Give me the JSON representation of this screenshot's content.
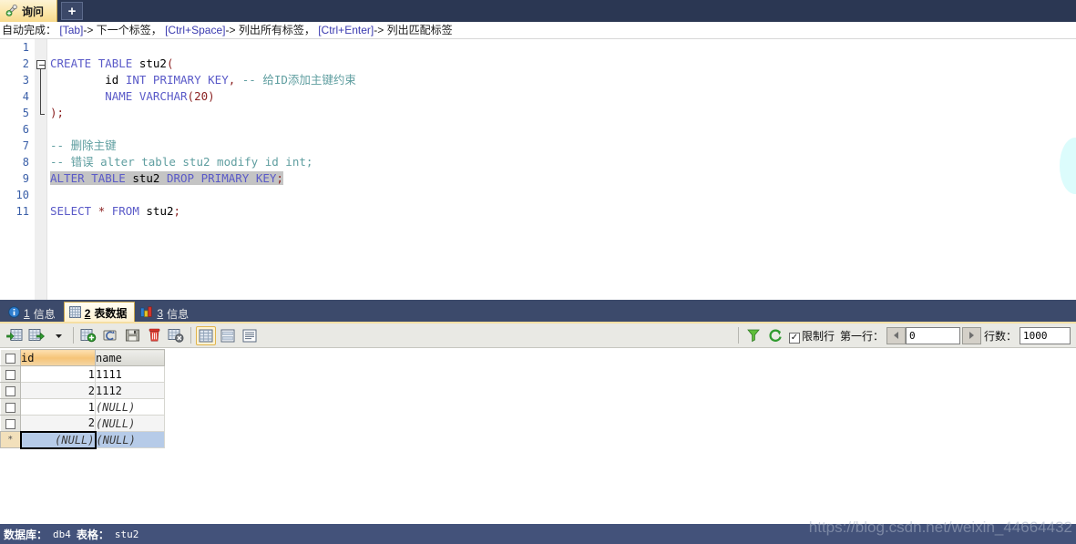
{
  "window": {
    "tab": {
      "label": "询问",
      "icon": "query-tab-icon"
    },
    "new_tab_label": "+"
  },
  "hint": {
    "prefix": "自动完成：",
    "items": [
      {
        "key": "[Tab]",
        "arrow": "->",
        "text": "下一个标签，"
      },
      {
        "key": "[Ctrl+Space]",
        "arrow": "->",
        "text": "列出所有标签，"
      },
      {
        "key": "[Ctrl+Enter]",
        "arrow": "->",
        "text": "列出匹配标签"
      }
    ]
  },
  "editor": {
    "line_numbers": [
      "1",
      "2",
      "3",
      "4",
      "5",
      "6",
      "7",
      "8",
      "9",
      "10",
      "11"
    ],
    "lines": [
      {
        "n": 1,
        "tokens": []
      },
      {
        "n": 2,
        "tokens": [
          {
            "t": "CREATE",
            "c": "kw"
          },
          {
            "t": " ",
            "c": "id"
          },
          {
            "t": "TABLE",
            "c": "kw"
          },
          {
            "t": " ",
            "c": "id"
          },
          {
            "t": "stu2",
            "c": "id"
          },
          {
            "t": "(",
            "c": "pn"
          }
        ]
      },
      {
        "n": 3,
        "tokens": [
          {
            "t": "        ",
            "c": "id"
          },
          {
            "t": "id",
            "c": "id"
          },
          {
            "t": " ",
            "c": "id"
          },
          {
            "t": "INT",
            "c": "kw"
          },
          {
            "t": " ",
            "c": "id"
          },
          {
            "t": "PRIMARY",
            "c": "kw"
          },
          {
            "t": " ",
            "c": "id"
          },
          {
            "t": "KEY",
            "c": "kw"
          },
          {
            "t": ",",
            "c": "pn"
          },
          {
            "t": " ",
            "c": "id"
          },
          {
            "t": "-- 给ID添加主键约束",
            "c": "cm"
          }
        ]
      },
      {
        "n": 4,
        "tokens": [
          {
            "t": "        ",
            "c": "id"
          },
          {
            "t": "NAME",
            "c": "kw"
          },
          {
            "t": " ",
            "c": "id"
          },
          {
            "t": "VARCHAR",
            "c": "kw"
          },
          {
            "t": "(",
            "c": "pn"
          },
          {
            "t": "20",
            "c": "pn"
          },
          {
            "t": ")",
            "c": "pn"
          }
        ]
      },
      {
        "n": 5,
        "tokens": [
          {
            "t": ")",
            "c": "pn"
          },
          {
            "t": ";",
            "c": "pn"
          }
        ]
      },
      {
        "n": 6,
        "tokens": []
      },
      {
        "n": 7,
        "tokens": [
          {
            "t": "-- 删除主键",
            "c": "cm"
          }
        ]
      },
      {
        "n": 8,
        "tokens": [
          {
            "t": "-- 错误 alter table stu2 modify id int;",
            "c": "cm"
          }
        ]
      },
      {
        "n": 9,
        "selected": true,
        "tokens": [
          {
            "t": "ALTER",
            "c": "kw"
          },
          {
            "t": " ",
            "c": "id"
          },
          {
            "t": "TABLE",
            "c": "kw"
          },
          {
            "t": " ",
            "c": "id"
          },
          {
            "t": "stu2",
            "c": "id"
          },
          {
            "t": " ",
            "c": "id"
          },
          {
            "t": "DROP",
            "c": "kw"
          },
          {
            "t": " ",
            "c": "id"
          },
          {
            "t": "PRIMARY",
            "c": "kw"
          },
          {
            "t": " ",
            "c": "id"
          },
          {
            "t": "KEY",
            "c": "kw"
          },
          {
            "t": ";",
            "c": "pn"
          }
        ]
      },
      {
        "n": 10,
        "tokens": []
      },
      {
        "n": 11,
        "tokens": [
          {
            "t": "SELECT",
            "c": "kw"
          },
          {
            "t": " ",
            "c": "id"
          },
          {
            "t": "*",
            "c": "pn"
          },
          {
            "t": " ",
            "c": "id"
          },
          {
            "t": "FROM",
            "c": "kw"
          },
          {
            "t": " ",
            "c": "id"
          },
          {
            "t": "stu2",
            "c": "id"
          },
          {
            "t": ";",
            "c": "pn"
          }
        ]
      }
    ]
  },
  "result_tabs": [
    {
      "num": "1",
      "label": "信息",
      "icon": "info-icon",
      "active": false
    },
    {
      "num": "2",
      "label": "表数据",
      "icon": "grid-icon",
      "active": true
    },
    {
      "num": "3",
      "label": "信息",
      "icon": "chart-icon",
      "active": false
    }
  ],
  "grid_toolbar": {
    "buttons": [
      {
        "name": "import-wizard-icon",
        "title": ""
      },
      {
        "name": "export-wizard-icon",
        "title": ""
      },
      {
        "name": "export-dropdown-icon",
        "title": ""
      },
      {
        "name": "add-record-icon",
        "title": ""
      },
      {
        "name": "apply-changes-icon",
        "title": ""
      },
      {
        "name": "save-record-icon",
        "title": ""
      },
      {
        "name": "delete-record-icon",
        "title": ""
      },
      {
        "name": "refresh-grid-icon",
        "title": ""
      },
      {
        "name": "grid-view-icon",
        "title": "",
        "pressed": true
      },
      {
        "name": "form-view-icon",
        "title": ""
      },
      {
        "name": "text-view-icon",
        "title": ""
      },
      {
        "name": "filter-icon",
        "title": ""
      },
      {
        "name": "refresh-icon",
        "title": ""
      }
    ],
    "limit_checkbox": {
      "checked": true,
      "mark": "✓",
      "label": "限制行"
    },
    "first_row_label": "第一行：",
    "first_row_value": "0",
    "row_count_label": "行数：",
    "row_count_value": "1000",
    "prev_arrow": "◀",
    "next_arrow": "▶"
  },
  "grid": {
    "columns": [
      {
        "label": "id",
        "primary_key": true
      },
      {
        "label": "name",
        "primary_key": false
      }
    ],
    "rows": [
      {
        "id": "1",
        "name": "1111",
        "alt": false
      },
      {
        "id": "2",
        "name": "1112",
        "alt": true
      },
      {
        "id": "1",
        "name": "(NULL)",
        "alt": false,
        "name_null": true
      },
      {
        "id": "2",
        "name": "(NULL)",
        "alt": true,
        "name_null": true
      }
    ],
    "new_row": {
      "marker": "*",
      "id": "(NULL)",
      "name": "(NULL)"
    }
  },
  "status": {
    "db_label": "数据库：",
    "db_value": "db4",
    "table_label": "表格：",
    "table_value": "stu2",
    "watermark": "https://blog.csdn.net/weixin_44664432"
  },
  "colors": {
    "titlebar": "#2b3753",
    "tab_active": "#fbe7ac",
    "result_bar": "#3c4a6b",
    "statusbar": "#43527a",
    "keyword": "#5a5ac8",
    "comment": "#5f9ea0",
    "punct": "#8b2222",
    "pk_header": "#f6c477",
    "selection": "#c4c4c4"
  }
}
